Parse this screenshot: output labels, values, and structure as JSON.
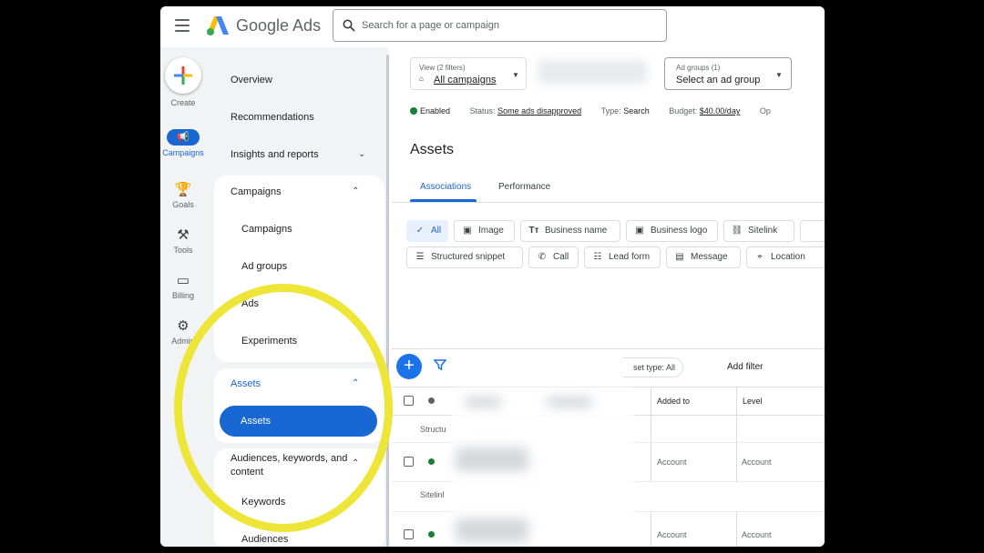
{
  "app": {
    "brand": "Google Ads"
  },
  "search": {
    "placeholder": "Search for a page or campaign"
  },
  "rail": {
    "create": "Create",
    "campaigns": "Campaigns",
    "goals": "Goals",
    "tools": "Tools",
    "billing": "Billing",
    "admin": "Admin"
  },
  "nav": {
    "overview": "Overview",
    "recommendations": "Recommendations",
    "insights": "Insights and reports",
    "campaigns_group": "Campaigns",
    "campaigns_item": "Campaigns",
    "ad_groups": "Ad groups",
    "ads_partial": "Ads",
    "experiments": "Experiments",
    "assets_group": "Assets",
    "assets_item": "Assets",
    "audiences_group": "Audiences, keywords, and content",
    "keywords": "Keywords",
    "audiences": "Audiences"
  },
  "header": {
    "view_small": "View (2 filters)",
    "view_big": "All campaigns",
    "adgroups_small": "Ad groups (1)",
    "adgroups_big": "Select an ad group"
  },
  "status": {
    "enabled": "Enabled",
    "status_label": "Status:",
    "status_value": "Some ads disapproved",
    "type_label": "Type:",
    "type_value": "Search",
    "budget_label": "Budget:",
    "budget_value": "$40.00/day",
    "op": "Op"
  },
  "page_title": "Assets",
  "tabs": {
    "associations": "Associations",
    "performance": "Performance"
  },
  "chips": {
    "all": "All",
    "image": "Image",
    "business_name": "Business name",
    "business_logo": "Business logo",
    "sitelink": "Sitelink",
    "structured_snippet": "Structured snippet",
    "call": "Call",
    "lead_form": "Lead form",
    "message": "Message",
    "location": "Location"
  },
  "table": {
    "asset_type_chip": "set type: All",
    "add_filter": "Add filter",
    "col_added_to": "Added to",
    "col_level": "Level",
    "group1": "Structu",
    "group2": "Sitelinl",
    "row1_added_to": "Account",
    "row1_level": "Account",
    "row2_added_to": "Account",
    "row2_level": "Account"
  },
  "colors": {
    "accent": "#1967d2",
    "enabled": "#188038",
    "highlight": "#ede638"
  }
}
